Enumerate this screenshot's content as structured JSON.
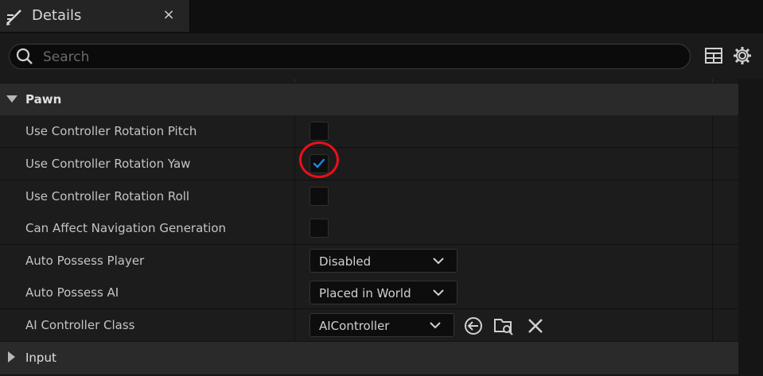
{
  "tab": {
    "title": "Details",
    "icon": "edit-pencil-icon",
    "close_glyph": "×"
  },
  "search": {
    "placeholder": "Search",
    "value": ""
  },
  "toolbar": {
    "icons": [
      "property-matrix-icon",
      "settings-gear-icon"
    ]
  },
  "categories": {
    "pawn": {
      "label": "Pawn",
      "expanded": true
    },
    "input": {
      "label": "Input",
      "expanded": false
    }
  },
  "properties": {
    "pitch": {
      "label": "Use Controller Rotation Pitch",
      "checked": false
    },
    "yaw": {
      "label": "Use Controller Rotation Yaw",
      "checked": true
    },
    "roll": {
      "label": "Use Controller Rotation Roll",
      "checked": false
    },
    "nav": {
      "label": "Can Affect Navigation Generation",
      "checked": false
    },
    "auto_player": {
      "label": "Auto Possess Player",
      "value": "Disabled"
    },
    "auto_ai": {
      "label": "Auto Possess AI",
      "value": "Placed in World"
    },
    "ai_class": {
      "label": "AI Controller Class",
      "value": "AIController"
    }
  },
  "colors": {
    "accent_check": "#1e8ae0",
    "annotation": "#e8101a"
  }
}
